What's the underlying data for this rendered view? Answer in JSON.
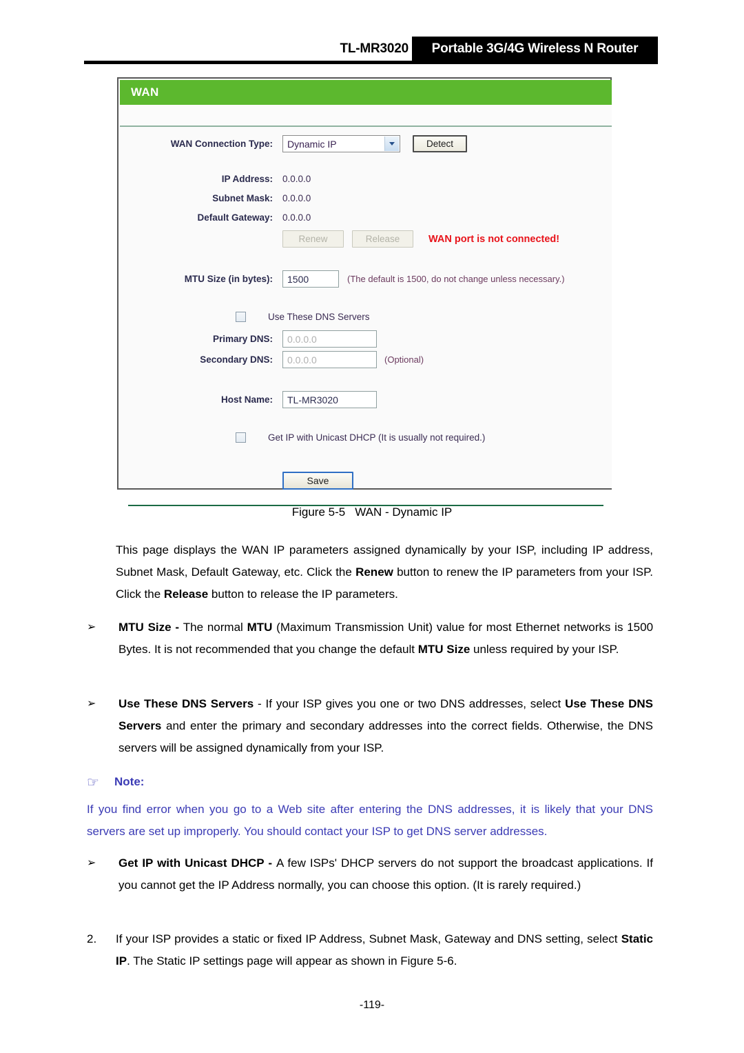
{
  "header": {
    "model": "TL-MR3020",
    "product": "Portable 3G/4G Wireless N Router"
  },
  "screenshot": {
    "panel_title": "WAN",
    "connection_type_label": "WAN Connection Type:",
    "connection_type_value": "Dynamic IP",
    "detect_button": "Detect",
    "ip_address_label": "IP Address:",
    "ip_address_value": "0.0.0.0",
    "subnet_mask_label": "Subnet Mask:",
    "subnet_mask_value": "0.0.0.0",
    "default_gateway_label": "Default Gateway:",
    "default_gateway_value": "0.0.0.0",
    "renew_button": "Renew",
    "release_button": "Release",
    "wan_status": "WAN port is not connected!",
    "mtu_label": "MTU Size (in bytes):",
    "mtu_value": "1500",
    "mtu_hint": "(The default is 1500, do not change unless necessary.)",
    "use_dns_label": "Use These DNS Servers",
    "primary_dns_label": "Primary DNS:",
    "primary_dns_value": "0.0.0.0",
    "secondary_dns_label": "Secondary DNS:",
    "secondary_dns_value": "0.0.0.0",
    "secondary_dns_hint": "(Optional)",
    "host_name_label": "Host Name:",
    "host_name_value": "TL-MR3020",
    "unicast_dhcp_label": "Get IP with Unicast DHCP (It is usually not required.)",
    "save_button": "Save"
  },
  "figure": {
    "number": "Figure 5-5",
    "title": "WAN - Dynamic IP"
  },
  "body": {
    "intro_1": "This page displays the WAN IP parameters assigned dynamically by your ISP, including IP address, Subnet Mask, Default Gateway, etc. Click the ",
    "intro_renew": "Renew",
    "intro_2": " button to renew the IP parameters from your ISP. Click the ",
    "intro_release": "Release",
    "intro_3": " button to release the IP parameters.",
    "bullet_marker": "➢",
    "b1_term": "MTU Size",
    "b1_dash": " - ",
    "b1_t1": "The normal ",
    "b1_bold1": "MTU",
    "b1_t2": " (Maximum Transmission Unit) value for most Ethernet networks is 1500 Bytes. It is not recommended that you change the default ",
    "b1_bold2": "MTU Size",
    "b1_t3": " unless required by your ISP.",
    "b2_term": "Use These DNS Servers",
    "b2_dash": " - ",
    "b2_t1": "If your ISP gives you one or two DNS addresses, select ",
    "b2_bold1": "Use These DNS Servers",
    "b2_t2": " and enter the primary and secondary addresses into the correct fields. Otherwise, the DNS servers will be assigned dynamically from your ISP.",
    "note_hand": "☞",
    "note_title": "Note:",
    "note_text": "If you find error when you go to a Web site after entering the DNS addresses, it is likely that your DNS servers are set up improperly. You should contact your ISP to get DNS server addresses.",
    "b3_term": "Get IP with Unicast DHCP",
    "b3_dash": " - ",
    "b3_t1": "A few ISPs' DHCP servers do not support the broadcast applications. If you cannot get the IP Address normally, you can choose this option. (It is rarely required.)",
    "n2_marker": "2.",
    "n2_t1": "If your ISP provides a static or fixed IP Address, Subnet Mask, Gateway and DNS setting, select ",
    "n2_bold1": "Static IP",
    "n2_t2": ". The Static IP settings page will appear as shown in Figure 5-6."
  },
  "footer": {
    "page_number": "-119-"
  },
  "colors": {
    "panel_green": "#5cb82e",
    "warning_red": "#e8131a",
    "note_blue": "#3b3bb5"
  }
}
